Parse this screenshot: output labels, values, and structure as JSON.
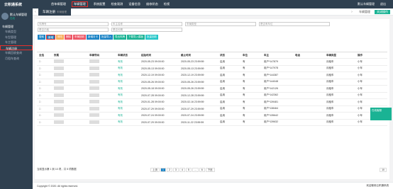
{
  "app": {
    "logo": "云积通系统",
    "user": "默认车辆管理",
    "status": "在线"
  },
  "topnav": [
    "首车辆管理",
    "车辆管理",
    "系统配置",
    "检查观测",
    "设备信息",
    "维修状态",
    "检视"
  ],
  "topright": [
    "默认车辆管理",
    "退出"
  ],
  "sidebar": {
    "group": "车辆管理",
    "items": [
      "车辆类型",
      "车型管理",
      "车主管理",
      "车辆注册",
      "车辆回收查询",
      "月租车查询"
    ]
  },
  "tabs": {
    "active": "车辆注册",
    "sub": "车辆管理",
    "right": [
      "车辆管理",
      "关闭操作"
    ]
  },
  "filters": {
    "f1": "车牌号",
    "f2": "车主名称",
    "f3": "车辆类型",
    "f4": "请选择",
    "f5": "是否有车位",
    "f6": "请选择",
    "f7": "是否已租",
    "f8": "是否长期",
    "f9": "搜索日期",
    "f10": "搜索"
  },
  "buttons": [
    "搜索",
    "新增",
    "修改",
    "删除",
    "车辆回收",
    "新增月卡",
    "批量导入",
    "导出车牌",
    "下载导入模板",
    "批量回收"
  ],
  "headers": [
    "全选",
    "所属",
    "车辆号码",
    "车辆状态",
    "起始时间",
    "截止时间",
    "状态",
    "车位",
    "车主",
    "电话",
    "车辆类型",
    "操作"
  ],
  "rows": [
    {
      "status": "有效",
      "start": "2020-05-23 09:00:00",
      "end": "2020-05-23 23:59:59",
      "state": "启用",
      "lot": "有",
      "owner": "用户*147879",
      "type": "月租车",
      "op": "小车"
    },
    {
      "status": "有效",
      "start": "2020-05-13 09:00:00",
      "end": "2020-05-13 23:59:59",
      "state": "启用",
      "lot": "有",
      "owner": "用户*147978",
      "type": "月租车",
      "op": "小车"
    },
    {
      "status": "有效",
      "start": "2020-12-19 09:00:00",
      "end": "2020-12-19 23:59:59",
      "state": "启用",
      "lot": "有",
      "owner": "用户*144387",
      "type": "月租车",
      "op": "小车"
    },
    {
      "status": "有效",
      "start": "2020-05-26 09:00:00",
      "end": "2020-05-26 23:59:59",
      "state": "启用",
      "lot": "有",
      "owner": "用户*144048",
      "type": "月租车",
      "op": "小车"
    },
    {
      "status": "有效",
      "start": "2020-05-18 09:00:00",
      "end": "2020-05-26 23:59:59",
      "state": "启用",
      "lot": "有",
      "owner": "用户*142126",
      "type": "月租车",
      "op": "小车"
    },
    {
      "status": "有效",
      "start": "2020-07-28 09:00:00",
      "end": "2020-12-28 23:59:59",
      "state": "启用",
      "lot": "有",
      "owner": "用户*142362",
      "type": "月租车",
      "op": "小车"
    },
    {
      "status": "有效",
      "start": "2020-01-28 09:00:00",
      "end": "2020-02-16 23:59:59",
      "state": "启用",
      "lot": "有",
      "owner": "用户*139481",
      "type": "月租车",
      "op": "小车"
    },
    {
      "status": "有效",
      "start": "2020-07-29 09:00:00",
      "end": "2020-07-29 23:59:59",
      "state": "启用",
      "lot": "有",
      "owner": "用户*138464",
      "type": "月租车",
      "op": "小车"
    },
    {
      "status": "有效",
      "start": "2020-07-24 09:00:00",
      "end": "2020-07-24 23:59:59",
      "state": "启用",
      "lot": "有",
      "owner": "用户*135642",
      "type": "月租车",
      "op": "小车"
    },
    {
      "status": "有效",
      "start": "2020-07-29 09:00:00",
      "end": "2020-11-22 23:59:59",
      "state": "启用",
      "lot": "有",
      "owner": "用户*139632",
      "type": "月租车",
      "op": "小车"
    }
  ],
  "pager": {
    "info": "当前显示第 1 到 10 项，共 5 项数据",
    "pages": [
      "上页",
      "1",
      "2",
      "3",
      "4",
      "5",
      "...",
      "6",
      "下页"
    ],
    "size": "10"
  },
  "footer": {
    "left": "Copyright © 2020. All rights reserved.",
    "right": "欢迎使用云积通系统"
  },
  "online": "在线客服"
}
